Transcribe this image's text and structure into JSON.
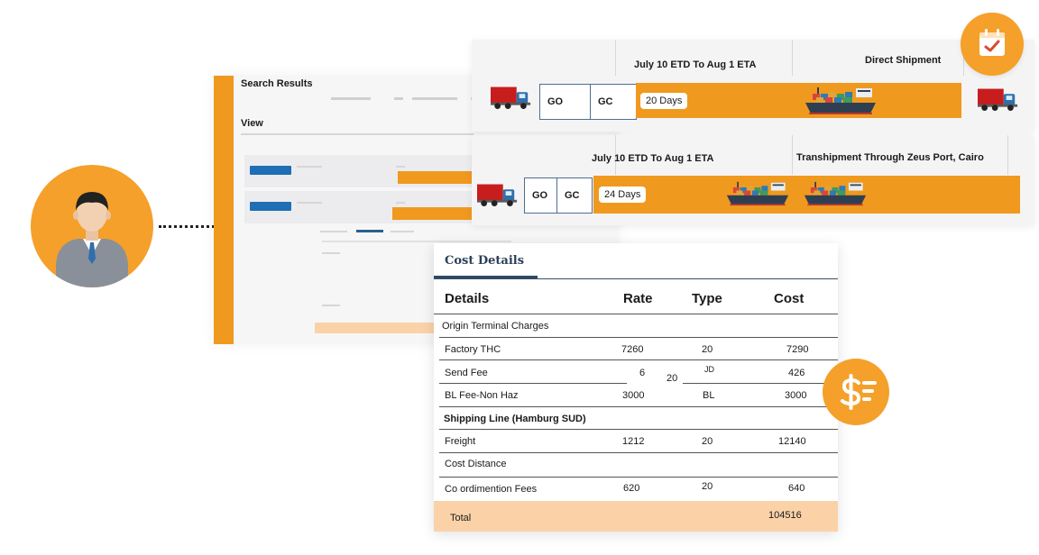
{
  "search_results": {
    "title": "Search Results",
    "view_label": "View"
  },
  "routes": [
    {
      "schedule": "July 10 ETD To Aug 1 ETA",
      "type": "Direct Shipment",
      "origin_code": "GO",
      "dest_code": "GC",
      "transit": "20 Days"
    },
    {
      "schedule": "July 10 ETD To Aug 1 ETA",
      "type": "Transhipment Through Zeus Port, Cairo",
      "origin_code": "GO",
      "dest_code": "GC",
      "transit": "24 Days"
    }
  ],
  "cost_details": {
    "title": "Cost Details",
    "headers": {
      "details": "Details",
      "rate": "Rate",
      "type": "Type",
      "cost": "Cost"
    },
    "rows": [
      {
        "label": "Origin Terminal Charges"
      },
      {
        "label": "Factory THC",
        "rate": "7260",
        "type": "20",
        "cost": "7290"
      },
      {
        "label": "Send Fee",
        "rate": "6",
        "type_a": "20",
        "type_b": "JD",
        "cost": "426"
      },
      {
        "label": "BL Fee-Non Haz",
        "rate": "3000",
        "type": "BL",
        "cost": "3000"
      },
      {
        "label": "Shipping Line (Hamburg SUD)"
      },
      {
        "label": "Freight",
        "rate": "1212",
        "type": "20",
        "cost": "12140"
      },
      {
        "label": "Cost Distance"
      },
      {
        "label": "Co ordimention Fees",
        "rate": "620",
        "type": "20",
        "cost": "640"
      }
    ],
    "total": {
      "label": "Total",
      "cost": "104516"
    }
  },
  "colors": {
    "accent_orange": "#f0991f",
    "icon_orange": "#f5a02a",
    "peach": "#fbd2a8",
    "navy": "#2c4966",
    "truck_red": "#c81d1d",
    "ship_hull": "#2f3f52"
  },
  "icons": {
    "avatar": "businessman-avatar-icon",
    "calendar": "calendar-check-icon",
    "dollar": "dollar-cost-icon",
    "truck": "truck-icon",
    "ship": "cargo-ship-icon"
  }
}
